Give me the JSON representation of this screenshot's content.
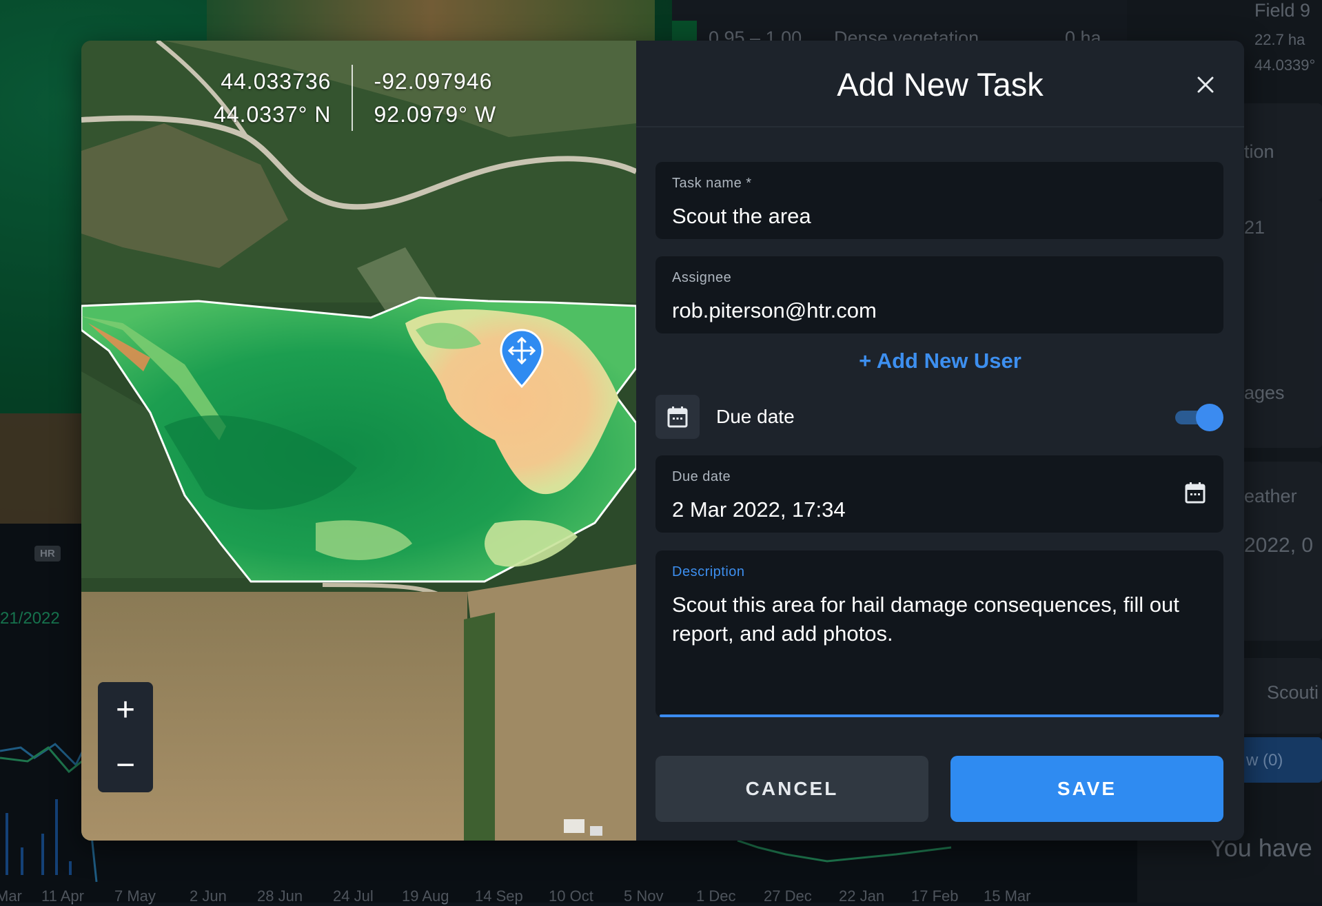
{
  "background": {
    "legend": {
      "range": "0.95 – 1.00",
      "label": "Dense vegetation",
      "area": "0 ha"
    },
    "field": {
      "name": "Field 9",
      "area": "22.7 ha",
      "coord": "44.0339°"
    },
    "section_fragment_1": "ation",
    "section_fragment_2": "21",
    "section_fragment_3": "ages",
    "section_fragment_4": "eather",
    "section_fragment_5": "2022, 0",
    "section_fragment_6": "Scouti",
    "section_fragment_7": "w (0)",
    "section_fragment_8": "You have",
    "hr_badge": "HR",
    "date_fragment": "21/2022",
    "x_axis": [
      "Mar",
      "11 Apr",
      "7 May",
      "2 Jun",
      "28 Jun",
      "24 Jul",
      "19 Aug",
      "14 Sep",
      "10 Oct",
      "5 Nov",
      "1 Dec",
      "27 Dec",
      "22 Jan",
      "17 Feb",
      "15 Mar"
    ]
  },
  "map": {
    "coord_decimal_lat": "44.033736",
    "coord_decimal_lon": "-92.097946",
    "coord_dms_lat": "44.0337° N",
    "coord_dms_lon": "92.0979° W",
    "zoom_in": "+",
    "zoom_out": "−"
  },
  "dialog": {
    "title": "Add New Task",
    "task_name_label": "Task name *",
    "task_name_value": "Scout the area",
    "assignee_label": "Assignee",
    "assignee_value": "rob.piterson@htr.com",
    "add_user_label": "+ Add New User",
    "due_toggle_label": "Due date",
    "due_toggle_on": true,
    "due_date_label": "Due date",
    "due_date_value": "2 Mar 2022, 17:34",
    "description_label": "Description",
    "description_value": "Scout this area for hail damage consequences, fill out report, and add photos.",
    "cancel_label": "CANCEL",
    "save_label": "SAVE"
  },
  "colors": {
    "accent": "#2f8bf1",
    "label_accent": "#3d8fef",
    "dialog_bg": "#1d232b",
    "field_bg": "#11161c"
  },
  "icons": {
    "close": "close-icon",
    "calendar": "calendar-icon",
    "pin": "map-pin-move-icon"
  }
}
